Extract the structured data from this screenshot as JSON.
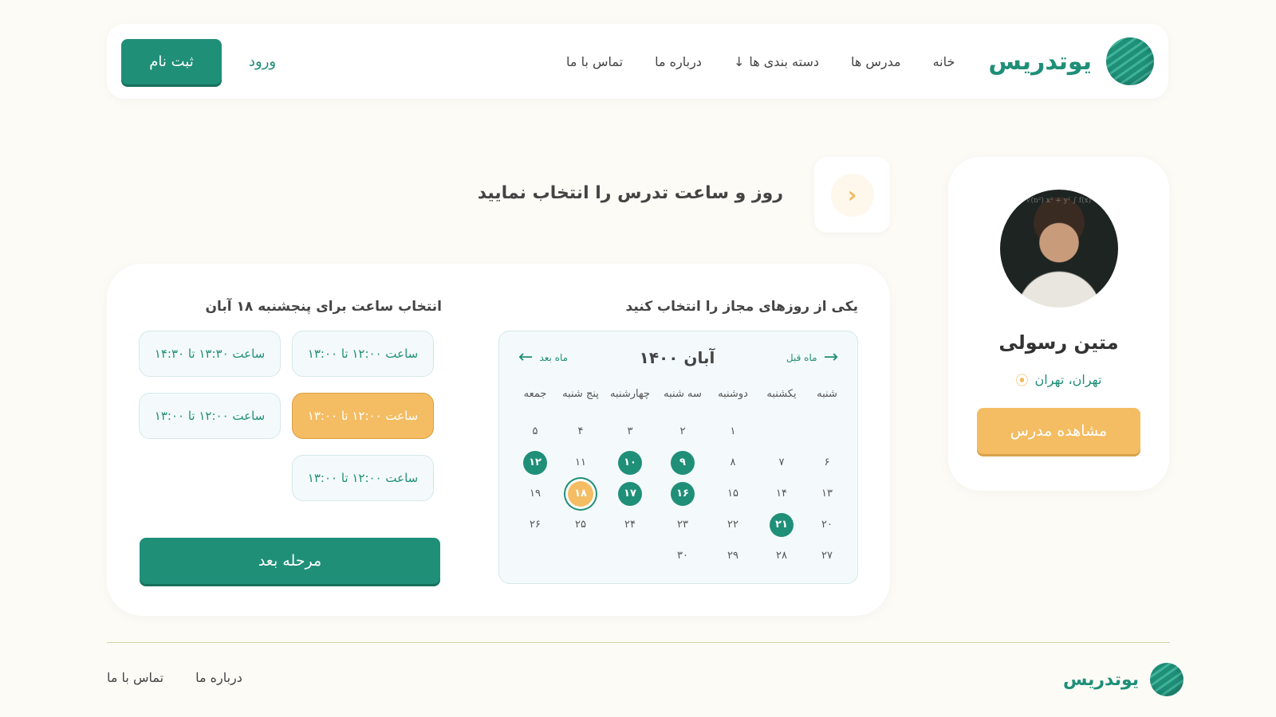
{
  "header": {
    "brand": "یوتدریس",
    "nav": [
      "خانه",
      "مدرس ها",
      "دسته بندی ها",
      "درباره ما",
      "تماس با ما"
    ],
    "login": "ورود",
    "signup": "ثبت نام"
  },
  "teacher": {
    "name": "متین رسولی",
    "location": "تهران، تهران",
    "view_button": "مشاهده مدرس"
  },
  "page": {
    "title": "روز و ساعت تدرس را انتخاب نمایید"
  },
  "calendar": {
    "section_title": "یکی از روزهای مجاز را انتخاب کنید",
    "month": "آبان ۱۴۰۰",
    "prev": "ماه قبل",
    "next": "ماه بعد",
    "weekdays": [
      "شنبه",
      "یکشنبه",
      "دوشنبه",
      "سه شنبه",
      "چهارشنبه",
      "پنج شنبه",
      "جمعه"
    ],
    "rows": [
      [
        "",
        "",
        "۱",
        "۲",
        "۳",
        "۴",
        "۵"
      ],
      [
        "۶",
        "۷",
        "۸",
        "۹",
        "۱۰",
        "۱۱",
        "۱۲"
      ],
      [
        "۱۳",
        "۱۴",
        "۱۵",
        "۱۶",
        "۱۷",
        "۱۸",
        "۱۹"
      ],
      [
        "۲۰",
        "۲۱",
        "۲۲",
        "۲۳",
        "۲۴",
        "۲۵",
        "۲۶"
      ],
      [
        "۲۷",
        "۲۸",
        "۲۹",
        "۳۰",
        "",
        "",
        ""
      ]
    ],
    "available": [
      "۹",
      "۱۰",
      "۱۲",
      "۱۶",
      "۱۷",
      "۲۱"
    ],
    "selected": "۱۸"
  },
  "times": {
    "section_title": "انتخاب ساعت برای پنجشنبه ۱۸ آبان",
    "slots": [
      "ساعت ۱۲:۰۰ تا ۱۳:۰۰",
      "ساعت ۱۳:۳۰ تا ۱۴:۳۰",
      "ساعت ۱۲:۰۰ تا ۱۳:۰۰",
      "ساعت ۱۲:۰۰ تا ۱۳:۰۰",
      "ساعت ۱۲:۰۰ تا ۱۳:۰۰"
    ],
    "active_slot": 2,
    "next_button": "مرحله بعد"
  },
  "footer": {
    "brand": "یوتدریس",
    "links": [
      "درباره ما",
      "تماس با ما"
    ]
  },
  "colors": {
    "primary": "#1f8f78",
    "accent": "#f4bd63",
    "background": "#fdfbf6"
  }
}
